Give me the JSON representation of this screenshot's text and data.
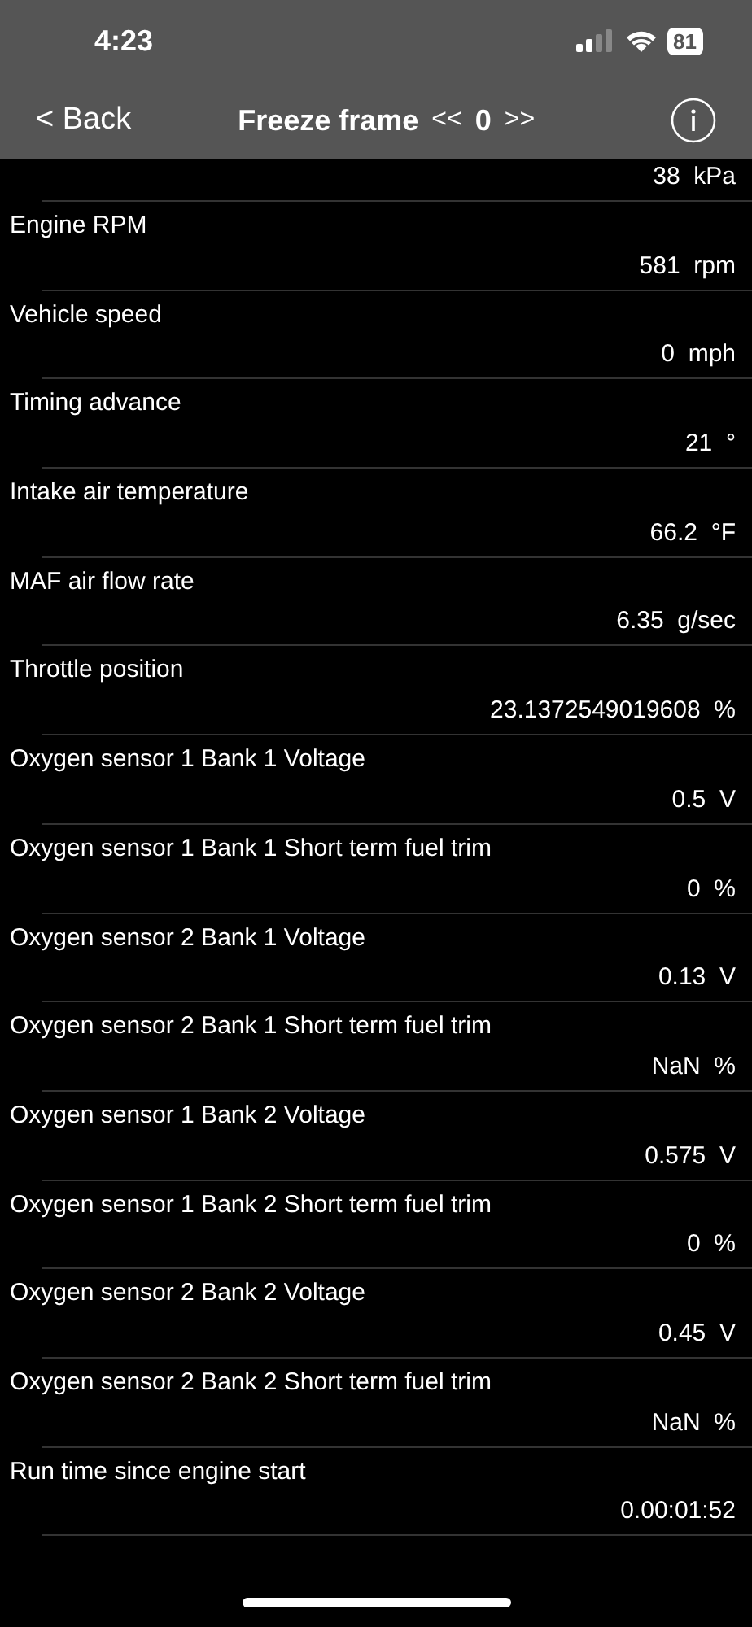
{
  "status_bar": {
    "time": "4:23",
    "battery": "81"
  },
  "nav": {
    "back": "< Back",
    "title": "Freeze frame",
    "prev": "<<",
    "index": "0",
    "next": ">>"
  },
  "partial_value": "38  kPa",
  "rows": [
    {
      "name": "Engine RPM",
      "value": "581  rpm"
    },
    {
      "name": "Vehicle speed",
      "value": "0  mph"
    },
    {
      "name": "Timing advance",
      "value": "21  °"
    },
    {
      "name": "Intake air temperature",
      "value": "66.2  °F"
    },
    {
      "name": "MAF air flow rate",
      "value": "6.35  g/sec"
    },
    {
      "name": "Throttle position",
      "value": "23.1372549019608  %"
    },
    {
      "name": "Oxygen sensor 1 Bank 1 Voltage",
      "value": "0.5  V"
    },
    {
      "name": "Oxygen sensor 1 Bank 1 Short term fuel trim",
      "value": "0  %"
    },
    {
      "name": "Oxygen sensor 2 Bank 1 Voltage",
      "value": "0.13  V"
    },
    {
      "name": "Oxygen sensor 2 Bank 1 Short term fuel trim",
      "value": "NaN  %"
    },
    {
      "name": "Oxygen sensor 1 Bank 2 Voltage",
      "value": "0.575  V"
    },
    {
      "name": "Oxygen sensor 1 Bank 2 Short term fuel trim",
      "value": "0  %"
    },
    {
      "name": "Oxygen sensor 2 Bank 2 Voltage",
      "value": "0.45  V"
    },
    {
      "name": "Oxygen sensor 2 Bank 2 Short term fuel trim",
      "value": "NaN  %"
    },
    {
      "name": "Run time since engine start",
      "value": "0.00:01:52"
    }
  ]
}
